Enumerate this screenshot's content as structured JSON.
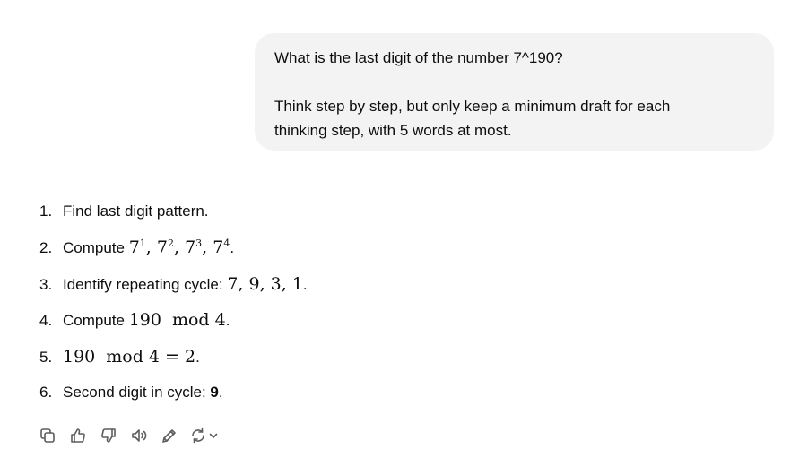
{
  "user_message": {
    "line1": "What is the last digit of the number 7^190?",
    "line2": "Think step by step, but only keep a minimum draft for each",
    "line3": "thinking step, with 5 words at most."
  },
  "steps": [
    {
      "num": "1.",
      "text": "Find last digit pattern."
    },
    {
      "num": "2.",
      "prefix": "Compute ",
      "base": "7",
      "powers": [
        "1",
        "2",
        "3",
        "4"
      ],
      "suffix": "."
    },
    {
      "num": "3.",
      "prefix": "Identify repeating cycle: ",
      "math": "7, 9, 3, 1",
      "suffix": "."
    },
    {
      "num": "4.",
      "prefix": "Compute ",
      "a": "190",
      "op": "mod",
      "b": "4",
      "suffix": "."
    },
    {
      "num": "5.",
      "a": "190",
      "op": "mod",
      "b": "4 = 2",
      "suffix": "."
    },
    {
      "num": "6.",
      "prefix": "Second digit in cycle: ",
      "answer": "9",
      "suffix": "."
    }
  ],
  "actions": [
    "copy-icon",
    "thumbs-up-icon",
    "thumbs-down-icon",
    "read-aloud-icon",
    "edit-icon",
    "regenerate-icon"
  ]
}
